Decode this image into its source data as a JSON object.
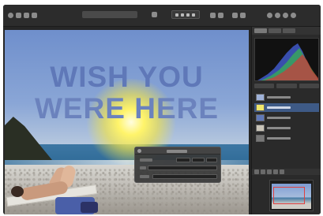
{
  "window": {
    "canvas": {
      "headline": {
        "line1": "WISH YOU",
        "line2": "WERE HERE"
      }
    }
  },
  "icons": {
    "toolbar_left": [
      "app-icon",
      "grid-icon",
      "move-icon",
      "crop-icon"
    ],
    "toolbar_right": [
      "share-icon",
      "undo-icon",
      "redo-icon",
      "zoom-icon"
    ]
  },
  "colors": {
    "headline": "#5f78b8",
    "panel_background": "#2a2a2a",
    "selection": "#3e5a86",
    "navigator_frame": "#e04040"
  }
}
